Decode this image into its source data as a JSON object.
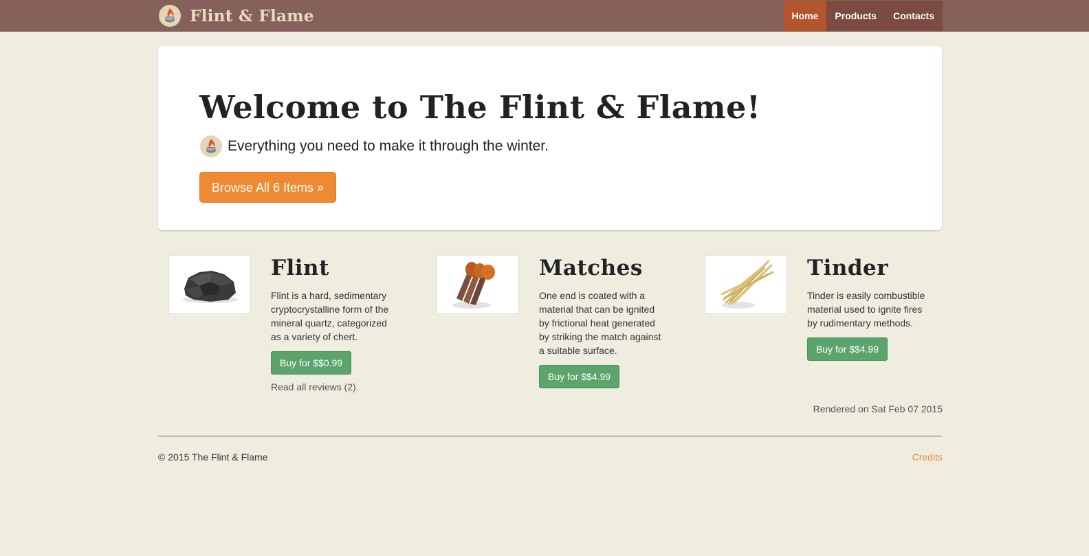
{
  "navbar": {
    "brand": "Flint & Flame",
    "items": [
      {
        "label": "Home",
        "active": true
      },
      {
        "label": "Products",
        "active": false
      },
      {
        "label": "Contacts",
        "active": false
      }
    ]
  },
  "hero": {
    "title": "Welcome to The Flint & Flame!",
    "tagline": "Everything you need to make it through the winter.",
    "browse_label": "Browse All 6 Items »"
  },
  "products": [
    {
      "name": "Flint",
      "icon": "flint-rock-icon",
      "description": "Flint is a hard, sedimentary cryptocrystalline form of the mineral quartz, categorized as a variety of chert.",
      "buy_label": "Buy for $$0.99",
      "reviews_label": "Read all reviews (2)."
    },
    {
      "name": "Matches",
      "icon": "matches-icon",
      "description": "One end is coated with a material that can be ignited by frictional heat generated by striking the match against a suitable surface.",
      "buy_label": "Buy for $$4.99"
    },
    {
      "name": "Tinder",
      "icon": "tinder-straw-icon",
      "description": "Tinder is easily combustible material used to ignite fires by rudimentary methods.",
      "buy_label": "Buy for $$4.99"
    }
  ],
  "rendered_text": "Rendered on Sat Feb 07 2015",
  "footer": {
    "copyright": "© 2015 The Flint & Flame",
    "credits_label": "Credits"
  },
  "colors": {
    "navbar": "#86605a",
    "nav_active": "#b5552e",
    "accent_orange": "#ee8a33",
    "buy_green": "#5ba46c",
    "page_bg": "#efece0"
  }
}
